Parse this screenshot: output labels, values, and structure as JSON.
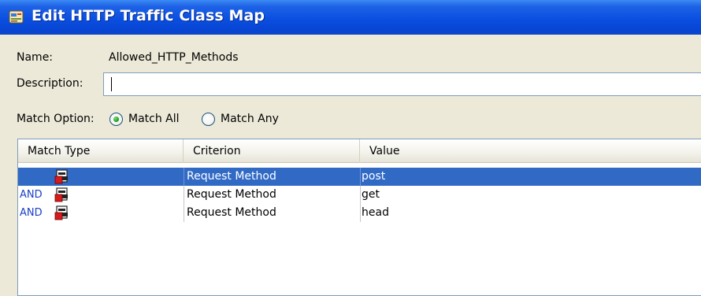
{
  "window": {
    "title": "Edit HTTP Traffic Class Map",
    "icon": "class-map-icon"
  },
  "form": {
    "name_label": "Name:",
    "name_value": "Allowed_HTTP_Methods",
    "description_label": "Description:",
    "description_value": "",
    "match_option_label": "Match Option:",
    "options": [
      {
        "label": "Match All",
        "selected": true
      },
      {
        "label": "Match Any",
        "selected": false
      }
    ]
  },
  "table": {
    "columns": [
      "Match Type",
      "Criterion",
      "Value"
    ],
    "rows": [
      {
        "conjunction": "",
        "icon": "match-rule-icon",
        "criterion": "Request Method",
        "value": "post",
        "selected": true
      },
      {
        "conjunction": "AND",
        "icon": "match-rule-icon",
        "criterion": "Request Method",
        "value": "get",
        "selected": false
      },
      {
        "conjunction": "AND",
        "icon": "match-rule-icon",
        "criterion": "Request Method",
        "value": "head",
        "selected": false
      }
    ]
  },
  "colors": {
    "titlebar": "#0a4fe0",
    "selection": "#316ac5",
    "conjunction_text": "#1a40c8",
    "window_bg": "#ece9d8"
  }
}
